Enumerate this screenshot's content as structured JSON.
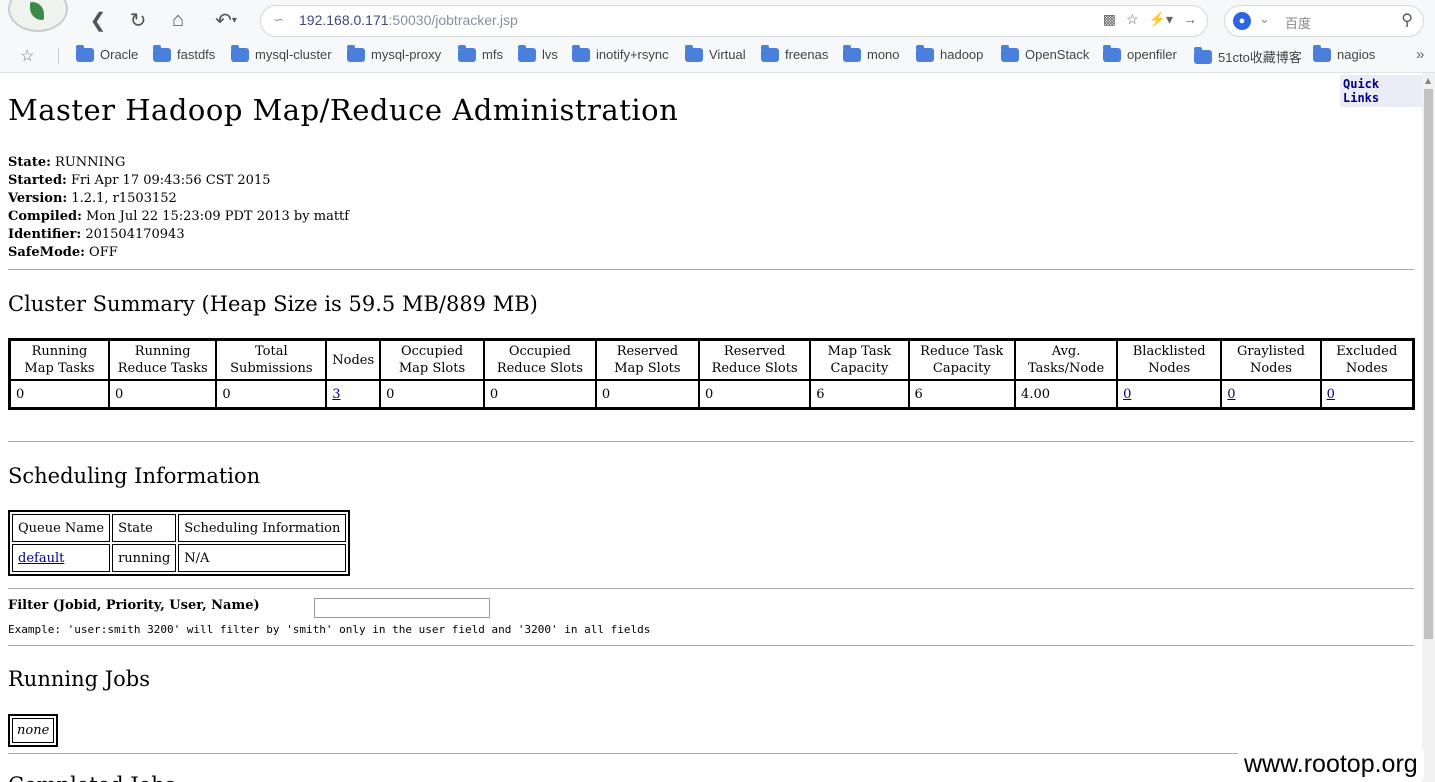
{
  "browser": {
    "url_host": "192.168.0.171",
    "url_rest": ":50030/jobtracker.jsp",
    "search_placeholder": "百度",
    "bookmarks": [
      "Oracle",
      "fastdfs",
      "mysql-cluster",
      "mysql-proxy",
      "mfs",
      "lvs",
      "inotify+rsync",
      "Virtual",
      "freenas",
      "mono",
      "hadoop",
      "OpenStack",
      "openfiler",
      "51cto收藏博客",
      "nagios"
    ]
  },
  "page": {
    "quick_links": "Quick Links",
    "title": "Master Hadoop Map/Reduce Administration",
    "info": [
      {
        "label": "State:",
        "value": " RUNNING"
      },
      {
        "label": "Started:",
        "value": " Fri Apr 17 09:43:56 CST 2015"
      },
      {
        "label": "Version:",
        "value": " 1.2.1, r1503152"
      },
      {
        "label": "Compiled:",
        "value": " Mon Jul 22 15:23:09 PDT 2013 by mattf"
      },
      {
        "label": "Identifier:",
        "value": " 201504170943"
      },
      {
        "label": "SafeMode:",
        "value": " OFF"
      }
    ],
    "cluster_summary_heading": "Cluster Summary (Heap Size is 59.5 MB/889 MB)",
    "cluster_summary": {
      "headers": [
        "Running Map Tasks",
        "Running Reduce Tasks",
        "Total Submissions",
        "Nodes",
        "Occupied Map Slots",
        "Occupied Reduce Slots",
        "Reserved Map Slots",
        "Reserved Reduce Slots",
        "Map Task Capacity",
        "Reduce Task Capacity",
        "Avg. Tasks/Node",
        "Blacklisted Nodes",
        "Graylisted Nodes",
        "Excluded Nodes"
      ],
      "values": [
        "0",
        "0",
        "0",
        "3",
        "0",
        "0",
        "0",
        "0",
        "6",
        "6",
        "4.00",
        "0",
        "0",
        "0"
      ]
    },
    "scheduling_heading": "Scheduling Information",
    "scheduling": {
      "headers": [
        "Queue Name",
        "State",
        "Scheduling Information"
      ],
      "row": [
        "default",
        "running",
        "N/A"
      ]
    },
    "filter_label": "Filter (Jobid, Priority, User, Name)",
    "filter_value": "",
    "filter_example": "Example: 'user:smith 3200' will filter by 'smith' only in the user field and '3200' in all fields",
    "running_jobs_heading": "Running Jobs",
    "running_jobs_none": "none",
    "next_heading_partial": "Completed Jobs",
    "watermark": "www.rootop.org"
  }
}
